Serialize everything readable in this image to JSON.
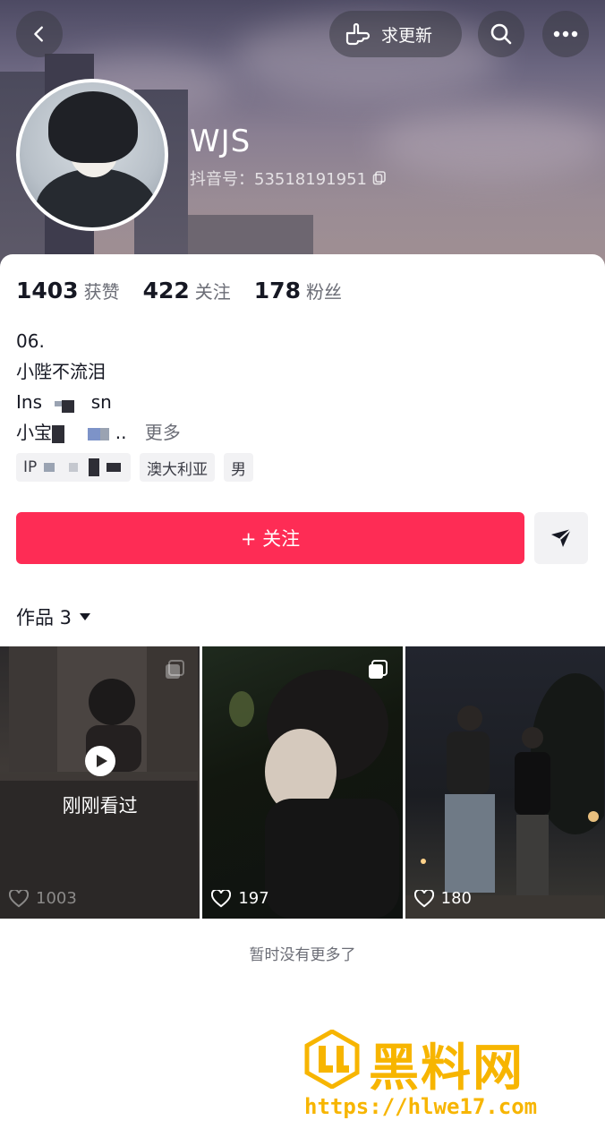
{
  "header": {
    "update_button_label": "求更新",
    "nickname": "WJS",
    "douyin_id": "抖音号：53518191951"
  },
  "stats": [
    {
      "value": "1403",
      "label": "获赞"
    },
    {
      "value": "422",
      "label": "关注"
    },
    {
      "value": "178",
      "label": "粉丝"
    }
  ],
  "bio": {
    "line1": "06.",
    "line2": "小陛不流泪",
    "line3_start": "Ins",
    "line3_end": "sn",
    "line4_start": "小宝",
    "line4_end": "..",
    "more_label": "更多"
  },
  "tags": {
    "ip_prefix": "IP",
    "location": "澳大利亚",
    "gender": "男"
  },
  "follow_button_label": "+ 关注",
  "works": {
    "title": "作品 3"
  },
  "videos": [
    {
      "likes": "1003",
      "overlay_label": "刚刚看过"
    },
    {
      "likes": "197"
    },
    {
      "likes": "180"
    }
  ],
  "end_note": "暂时没有更多了",
  "watermark": {
    "title": "黑料网",
    "url": "https://hlwe17.com"
  },
  "colors": {
    "accent": "#fe2c55",
    "watermark": "#f7b500"
  }
}
